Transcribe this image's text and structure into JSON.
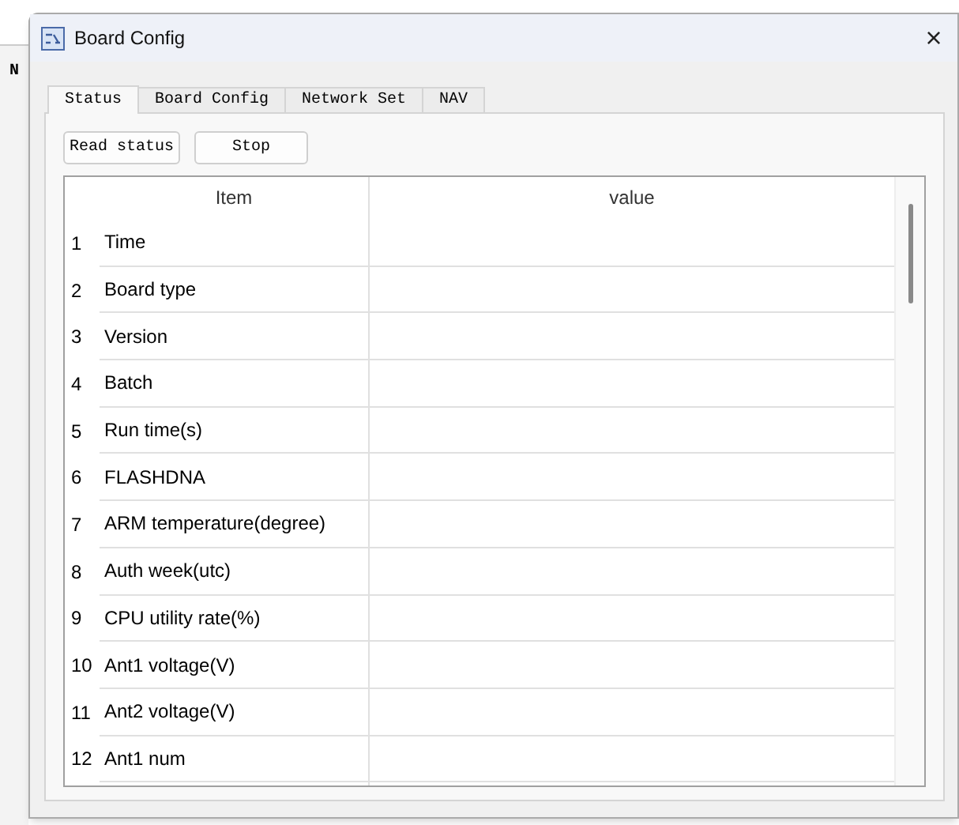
{
  "background_text": "N",
  "window": {
    "title": "Board Config",
    "close": "×"
  },
  "tabs": [
    {
      "label": "Status",
      "selected": true
    },
    {
      "label": "Board Config",
      "selected": false
    },
    {
      "label": "Network Set",
      "selected": false
    },
    {
      "label": "NAV",
      "selected": false
    }
  ],
  "buttons": [
    "Read status",
    "Stop"
  ],
  "table": {
    "columns": [
      "Item",
      "value"
    ],
    "rows": [
      {
        "index": "1",
        "item": "Time"
      },
      {
        "index": "2",
        "item": "Board type"
      },
      {
        "index": "3",
        "item": "Version"
      },
      {
        "index": "4",
        "item": "Batch"
      },
      {
        "index": "5",
        "item": "Run time(s)"
      },
      {
        "index": "6",
        "item": "FLASHDNA"
      },
      {
        "index": "7",
        "item": "ARM temperature(degree)"
      },
      {
        "index": "8",
        "item": "Auth week(utc)"
      },
      {
        "index": "9",
        "item": "CPU utility rate(%)"
      },
      {
        "index": "10",
        "item": "Ant1 voltage(V)"
      },
      {
        "index": "11",
        "item": "Ant2 voltage(V)"
      },
      {
        "index": "12",
        "item": "Ant1 num"
      }
    ]
  }
}
